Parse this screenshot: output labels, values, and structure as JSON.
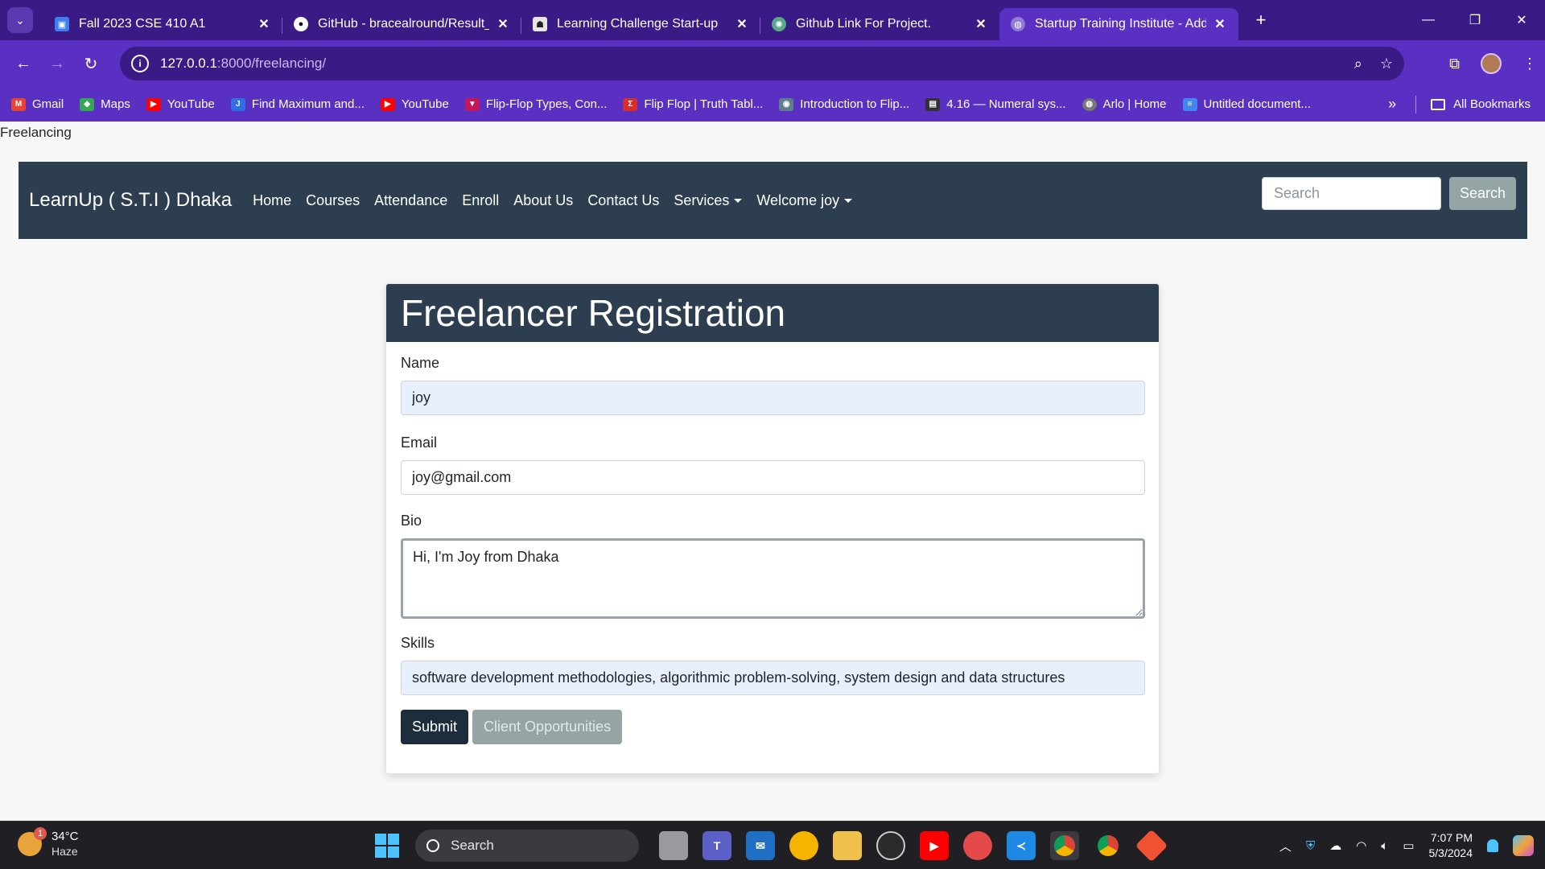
{
  "browser": {
    "tabs": [
      {
        "title": "Fall 2023 CSE 410 A1",
        "favicon_color": "#3d7ef0",
        "active": false
      },
      {
        "title": "GitHub - bracealround/Result_P",
        "favicon_color": "#111111",
        "active": false
      },
      {
        "title": "Learning Challenge Start-up",
        "favicon_color": "#444444",
        "active": false
      },
      {
        "title": "Github Link For Project.",
        "favicon_color": "#5aa88a",
        "active": false
      },
      {
        "title": "Startup Training Institute - Add",
        "favicon_color": "#8f7ad6",
        "active": true
      }
    ],
    "url_host": "127.0.0.1",
    "url_path": ":8000/freelancing/",
    "bookmarks": [
      {
        "label": "Gmail",
        "color": "#ea4335"
      },
      {
        "label": "Maps",
        "color": "#34a853"
      },
      {
        "label": "YouTube",
        "color": "#ff0000"
      },
      {
        "label": "Find Maximum and...",
        "color": "#2f6fe4"
      },
      {
        "label": "YouTube",
        "color": "#ff0000"
      },
      {
        "label": "Flip-Flop Types, Con...",
        "color": "#c2185b"
      },
      {
        "label": "Flip Flop | Truth Tabl...",
        "color": "#d32f2f"
      },
      {
        "label": "Introduction to Flip...",
        "color": "#607d8b"
      },
      {
        "label": "4.16 — Numeral sys...",
        "color": "#333333"
      },
      {
        "label": "Arlo | Home",
        "color": "#777777"
      },
      {
        "label": "Untitled document...",
        "color": "#4285f4"
      }
    ],
    "all_bookmarks_label": "All Bookmarks"
  },
  "page": {
    "document_title": "Freelancing",
    "nav": {
      "brand": "LearnUp ( S.T.I ) Dhaka",
      "links": [
        "Home",
        "Courses",
        "Attendance",
        "Enroll",
        "About Us",
        "Contact Us"
      ],
      "services_label": "Services",
      "welcome_label": "Welcome joy",
      "search_placeholder": "Search",
      "search_button": "Search"
    },
    "form": {
      "heading": "Freelancer Registration",
      "name_label": "Name",
      "name_value": "joy",
      "email_label": "Email",
      "email_value": "joy@gmail.com",
      "bio_label": "Bio",
      "bio_value": "Hi, I'm Joy from Dhaka",
      "skills_label": "Skills",
      "skills_value": "software development methodologies, algorithmic problem-solving, system design and data structures",
      "submit_label": "Submit",
      "client_label": "Client Opportunities"
    },
    "colors": {
      "navbar": "#2c3e50",
      "secondary_button": "#95a5a6"
    }
  },
  "taskbar": {
    "temperature": "34°C",
    "condition": "Haze",
    "weather_badge": "1",
    "search_label": "Search",
    "time": "7:07 PM",
    "date": "5/3/2024"
  }
}
